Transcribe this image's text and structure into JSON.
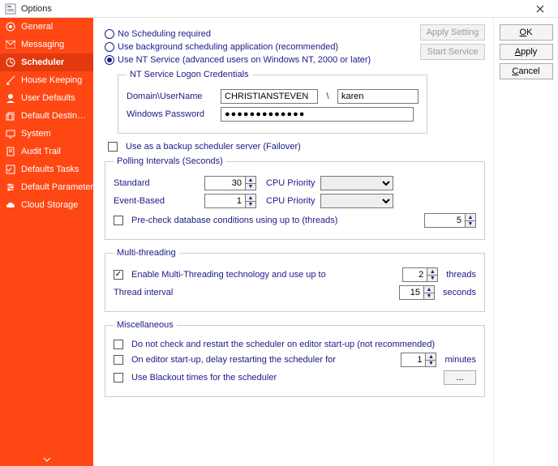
{
  "window": {
    "title": "Options"
  },
  "sidebar": {
    "items": [
      {
        "label": "General"
      },
      {
        "label": "Messaging"
      },
      {
        "label": "Scheduler"
      },
      {
        "label": "House Keeping"
      },
      {
        "label": "User Defaults"
      },
      {
        "label": "Default Destinations"
      },
      {
        "label": "System"
      },
      {
        "label": "Audit Trail"
      },
      {
        "label": "Defaults Tasks"
      },
      {
        "label": "Default Parameters"
      },
      {
        "label": "Cloud Storage"
      }
    ]
  },
  "scheduling": {
    "no_sched": "No Scheduling required",
    "bg_app": "Use background scheduling application (recommended)",
    "nt_service": "Use NT Service (advanced users on Windows NT, 2000 or later)"
  },
  "nt": {
    "legend": "NT Service Logon Credentials",
    "domain_user_label": "Domain\\UserName",
    "domain": "CHRISTIANSTEVEN",
    "sep": "\\",
    "user": "karen",
    "password_label": "Windows Password",
    "password": "●●●●●●●●●●●●●"
  },
  "backup": {
    "label": "Use as a backup scheduler server (Failover)"
  },
  "polling": {
    "legend": "Polling Intervals (Seconds)",
    "standard_label": "Standard",
    "standard_value": "30",
    "cpu_priority": "CPU Priority",
    "event_label": "Event-Based",
    "event_value": "1",
    "precheck": "Pre-check database conditions using up to (threads)",
    "precheck_value": "5"
  },
  "multithreading": {
    "legend": "Multi-threading",
    "enable": "Enable Multi-Threading technology and use up to",
    "enable_value": "2",
    "threads": "threads",
    "interval_label": "Thread interval",
    "interval_value": "15",
    "seconds": "seconds"
  },
  "misc": {
    "legend": "Miscellaneous",
    "no_restart": "Do not check and restart the scheduler on editor start-up (not recommended)",
    "delay": "On editor start-up, delay restarting the scheduler for",
    "delay_value": "1",
    "minutes": "minutes",
    "blackout": "Use Blackout times for the scheduler",
    "blackout_btn": "..."
  },
  "actions": {
    "apply_setting": "Apply Setting",
    "start_service": "Start Service"
  },
  "buttons": {
    "ok": "OK",
    "apply": "Apply",
    "cancel": "Cancel"
  }
}
